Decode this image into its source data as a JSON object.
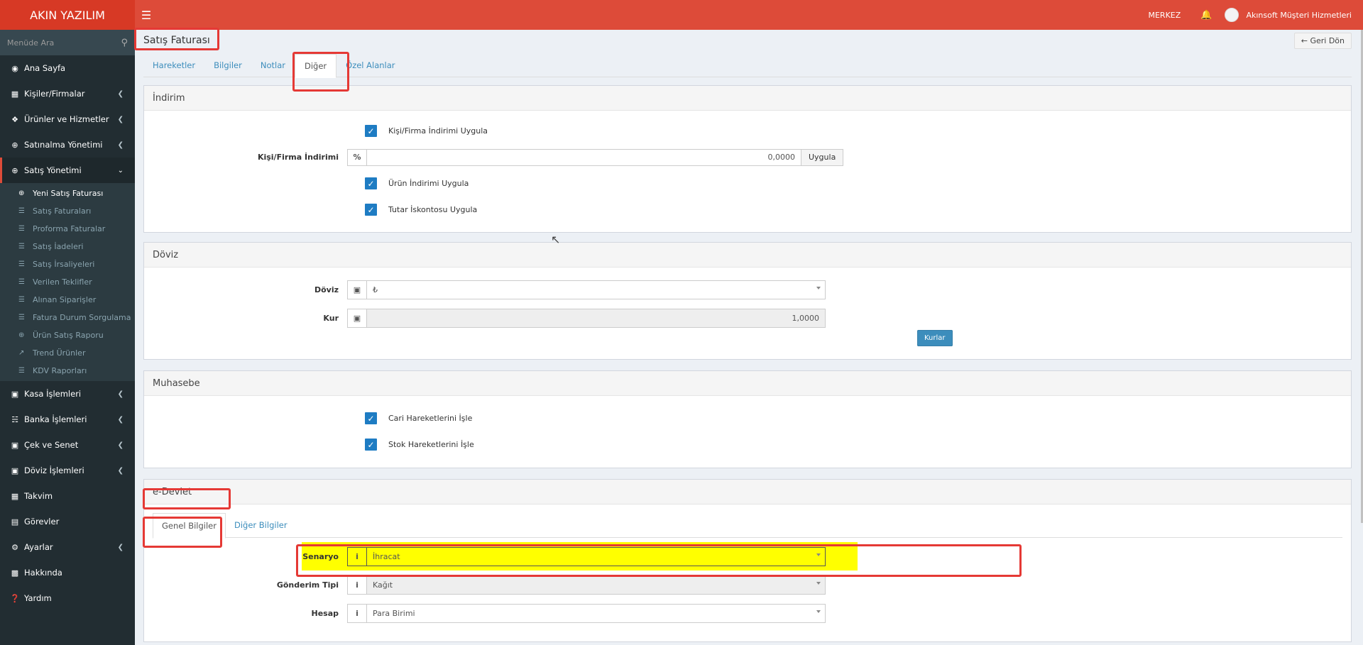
{
  "header": {
    "logo": "AKIN YAZILIM",
    "branch": "MERKEZ",
    "user": "Akınsoft Müşteri Hizmetleri"
  },
  "sidebar": {
    "search_placeholder": "Menüde Ara",
    "items": [
      {
        "label": "Ana Sayfa",
        "icon": "dashboard-icon"
      },
      {
        "label": "Kişiler/Firmalar",
        "icon": "contact-icon"
      },
      {
        "label": "Ürünler ve Hizmetler",
        "icon": "cubes-icon"
      },
      {
        "label": "Satınalma Yönetimi",
        "icon": "plus-circle-icon"
      },
      {
        "label": "Satış Yönetimi",
        "icon": "plus-circle-icon"
      }
    ],
    "sales_sub": [
      "Yeni Satış Faturası",
      "Satış Faturaları",
      "Proforma Faturalar",
      "Satış İadeleri",
      "Satış İrsaliyeleri",
      "Verilen Teklifler",
      "Alınan Siparişler",
      "Fatura Durum Sorgulama",
      "Ürün Satış Raporu",
      "Trend Ürünler",
      "KDV Raporları"
    ],
    "items_after": [
      "Kasa İşlemleri",
      "Banka İşlemleri",
      "Çek ve Senet",
      "Döviz İşlemleri",
      "Takvim",
      "Görevler",
      "Ayarlar",
      "Hakkında",
      "Yardım"
    ]
  },
  "page": {
    "title": "Satış Faturası",
    "back": "Geri Dön",
    "tabs": [
      "Hareketler",
      "Bilgiler",
      "Notlar",
      "Diğer",
      "Özel Alanlar"
    ]
  },
  "indirim": {
    "title": "İndirim",
    "chk1": "Kişi/Firma İndirimi Uygula",
    "label": "Kişi/Firma İndirimi",
    "addon": "%",
    "value": "0,0000",
    "apply": "Uygula",
    "chk2": "Ürün İndirimi Uygula",
    "chk3": "Tutar İskontosu Uygula"
  },
  "doviz": {
    "title": "Döviz",
    "currency_label": "Döviz",
    "currency_value": "₺",
    "rate_label": "Kur",
    "rate_value": "1,0000",
    "rates_button": "Kurlar"
  },
  "muhasebe": {
    "title": "Muhasebe",
    "chk1": "Cari Hareketlerini İşle",
    "chk2": "Stok Hareketlerini İşle"
  },
  "edevlet": {
    "title": "e-Devlet",
    "tabs": [
      "Genel Bilgiler",
      "Diğer Bilgiler"
    ],
    "senaryo_label": "Senaryo",
    "senaryo_value": "İhracat",
    "gonderim_label": "Gönderim Tipi",
    "gonderim_value": "Kağıt",
    "hesap_label": "Hesap",
    "hesap_value": "Para Birimi",
    "info_icon": "i"
  },
  "colors": {
    "header": "#dd4b39",
    "sidebar": "#222d32",
    "accent": "#3c8dbc",
    "highlight": "#ffff00",
    "annotation": "#e53935"
  }
}
